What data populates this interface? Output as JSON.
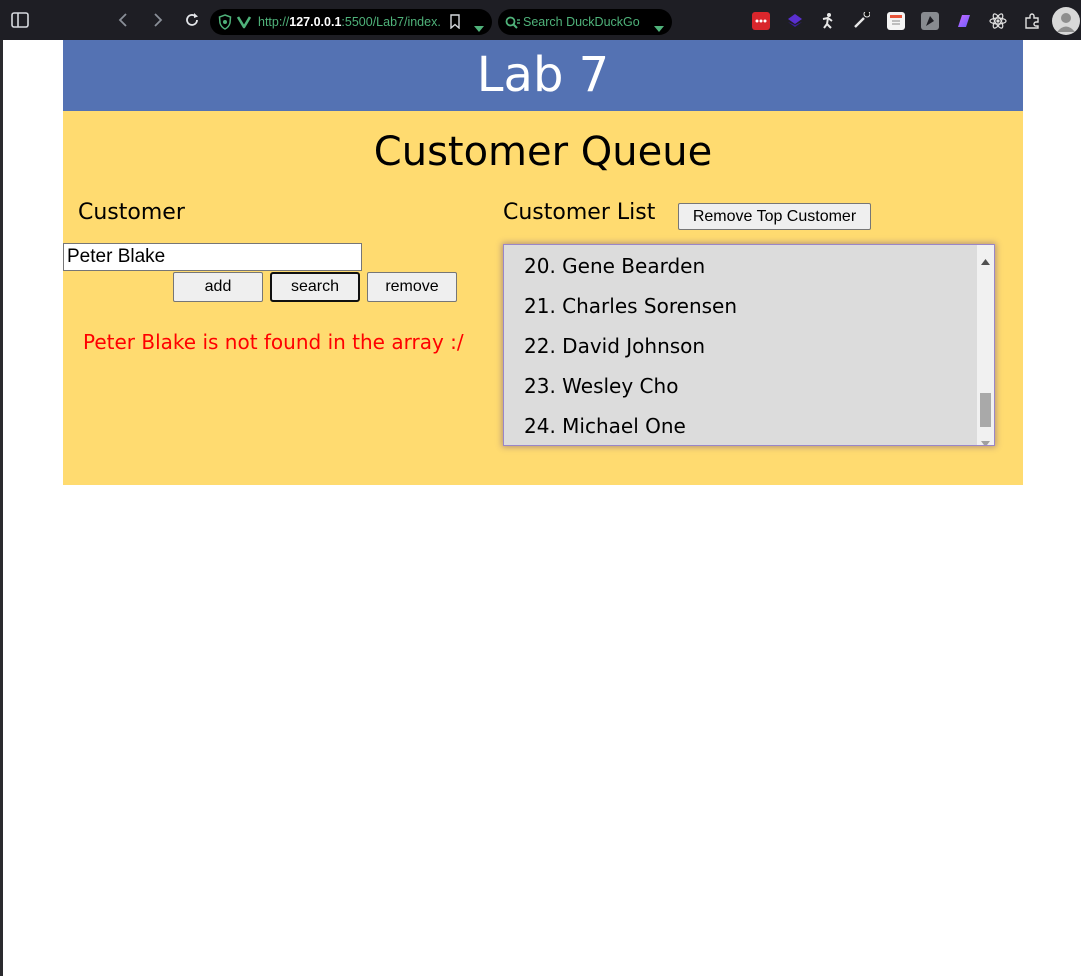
{
  "browser": {
    "url_prefix": "http://",
    "url_host": "127.0.0.1",
    "url_rest": ":5500/Lab7/index.",
    "search_placeholder": "Search DuckDuckGo",
    "accent": "#4fb27a"
  },
  "page": {
    "header_title": "Lab 7",
    "heading": "Customer Queue",
    "colors": {
      "header": "#5472b3",
      "main": "#ffdb70",
      "message": "#ff0000"
    }
  },
  "customer_form": {
    "label": "Customer",
    "input_value": "Peter Blake",
    "add_label": "add",
    "search_label": "search",
    "remove_label": "remove",
    "message": "Peter Blake is not found in the array :/"
  },
  "customer_list": {
    "label": "Customer List",
    "remove_top_label": "Remove Top Customer",
    "items": [
      "20. Gene Bearden",
      "21. Charles Sorensen",
      "22. David Johnson",
      "23. Wesley Cho",
      "24. Michael One"
    ]
  }
}
